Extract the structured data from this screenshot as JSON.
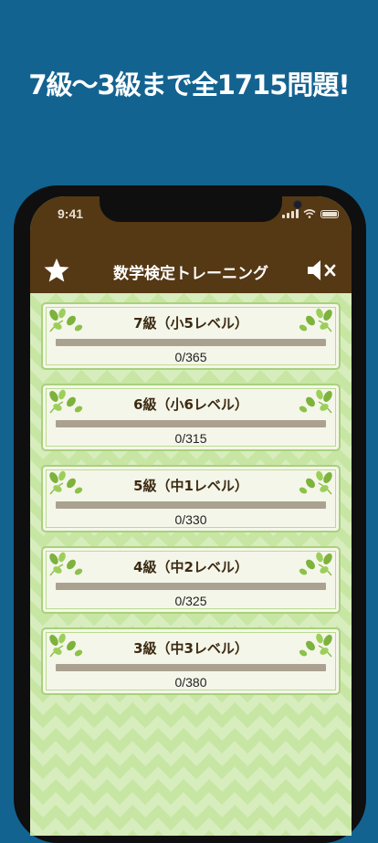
{
  "headline": "7級〜3級まで全1715問題!",
  "status": {
    "time": "9:41"
  },
  "nav": {
    "title": "数学検定トレーニング"
  },
  "icons": {
    "left": "star-icon",
    "right": "speaker-muted-icon"
  },
  "colors": {
    "background": "#136391",
    "bar": "#553814",
    "accent_green": "#6fae3a"
  },
  "levels": [
    {
      "title": "7級（小5レベル）",
      "progress_text": "0/365",
      "progress": 0
    },
    {
      "title": "6級（小6レベル）",
      "progress_text": "0/315",
      "progress": 0
    },
    {
      "title": "5級（中1レベル）",
      "progress_text": "0/330",
      "progress": 0
    },
    {
      "title": "4級（中2レベル）",
      "progress_text": "0/325",
      "progress": 0
    },
    {
      "title": "3級（中3レベル）",
      "progress_text": "0/380",
      "progress": 0
    }
  ]
}
